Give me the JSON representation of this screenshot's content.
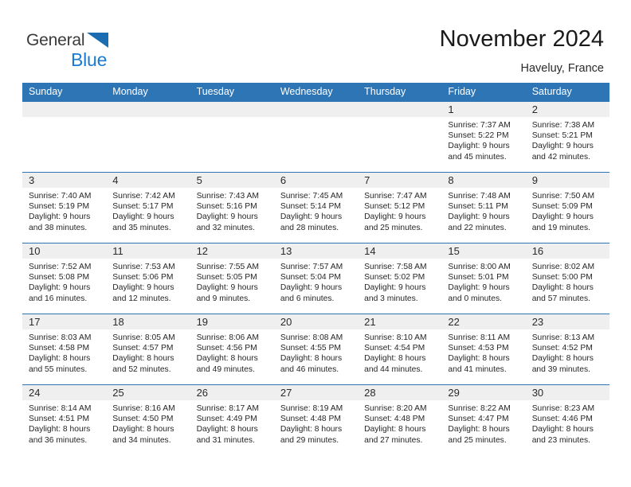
{
  "brand": {
    "name_part1": "General",
    "name_part2": "Blue",
    "logo_icon": "flag-triangle-icon",
    "accent_color": "#1b7ad1"
  },
  "header": {
    "title": "November 2024",
    "subtitle": "Haveluy, France"
  },
  "theme": {
    "header_blue": "#2e75b6",
    "daystrip_gray": "#efefef",
    "text_dark": "#262626"
  },
  "calendar": {
    "weekday_headers": [
      "Sunday",
      "Monday",
      "Tuesday",
      "Wednesday",
      "Thursday",
      "Friday",
      "Saturday"
    ],
    "weeks": [
      [
        {
          "day": "",
          "empty": true,
          "sunrise": "",
          "sunset": "",
          "daylight_line1": "",
          "daylight_line2": ""
        },
        {
          "day": "",
          "empty": true,
          "sunrise": "",
          "sunset": "",
          "daylight_line1": "",
          "daylight_line2": ""
        },
        {
          "day": "",
          "empty": true,
          "sunrise": "",
          "sunset": "",
          "daylight_line1": "",
          "daylight_line2": ""
        },
        {
          "day": "",
          "empty": true,
          "sunrise": "",
          "sunset": "",
          "daylight_line1": "",
          "daylight_line2": ""
        },
        {
          "day": "",
          "empty": true,
          "sunrise": "",
          "sunset": "",
          "daylight_line1": "",
          "daylight_line2": ""
        },
        {
          "day": "1",
          "empty": false,
          "sunrise": "Sunrise: 7:37 AM",
          "sunset": "Sunset: 5:22 PM",
          "daylight_line1": "Daylight: 9 hours",
          "daylight_line2": "and 45 minutes."
        },
        {
          "day": "2",
          "empty": false,
          "sunrise": "Sunrise: 7:38 AM",
          "sunset": "Sunset: 5:21 PM",
          "daylight_line1": "Daylight: 9 hours",
          "daylight_line2": "and 42 minutes."
        }
      ],
      [
        {
          "day": "3",
          "empty": false,
          "sunrise": "Sunrise: 7:40 AM",
          "sunset": "Sunset: 5:19 PM",
          "daylight_line1": "Daylight: 9 hours",
          "daylight_line2": "and 38 minutes."
        },
        {
          "day": "4",
          "empty": false,
          "sunrise": "Sunrise: 7:42 AM",
          "sunset": "Sunset: 5:17 PM",
          "daylight_line1": "Daylight: 9 hours",
          "daylight_line2": "and 35 minutes."
        },
        {
          "day": "5",
          "empty": false,
          "sunrise": "Sunrise: 7:43 AM",
          "sunset": "Sunset: 5:16 PM",
          "daylight_line1": "Daylight: 9 hours",
          "daylight_line2": "and 32 minutes."
        },
        {
          "day": "6",
          "empty": false,
          "sunrise": "Sunrise: 7:45 AM",
          "sunset": "Sunset: 5:14 PM",
          "daylight_line1": "Daylight: 9 hours",
          "daylight_line2": "and 28 minutes."
        },
        {
          "day": "7",
          "empty": false,
          "sunrise": "Sunrise: 7:47 AM",
          "sunset": "Sunset: 5:12 PM",
          "daylight_line1": "Daylight: 9 hours",
          "daylight_line2": "and 25 minutes."
        },
        {
          "day": "8",
          "empty": false,
          "sunrise": "Sunrise: 7:48 AM",
          "sunset": "Sunset: 5:11 PM",
          "daylight_line1": "Daylight: 9 hours",
          "daylight_line2": "and 22 minutes."
        },
        {
          "day": "9",
          "empty": false,
          "sunrise": "Sunrise: 7:50 AM",
          "sunset": "Sunset: 5:09 PM",
          "daylight_line1": "Daylight: 9 hours",
          "daylight_line2": "and 19 minutes."
        }
      ],
      [
        {
          "day": "10",
          "empty": false,
          "sunrise": "Sunrise: 7:52 AM",
          "sunset": "Sunset: 5:08 PM",
          "daylight_line1": "Daylight: 9 hours",
          "daylight_line2": "and 16 minutes."
        },
        {
          "day": "11",
          "empty": false,
          "sunrise": "Sunrise: 7:53 AM",
          "sunset": "Sunset: 5:06 PM",
          "daylight_line1": "Daylight: 9 hours",
          "daylight_line2": "and 12 minutes."
        },
        {
          "day": "12",
          "empty": false,
          "sunrise": "Sunrise: 7:55 AM",
          "sunset": "Sunset: 5:05 PM",
          "daylight_line1": "Daylight: 9 hours",
          "daylight_line2": "and 9 minutes."
        },
        {
          "day": "13",
          "empty": false,
          "sunrise": "Sunrise: 7:57 AM",
          "sunset": "Sunset: 5:04 PM",
          "daylight_line1": "Daylight: 9 hours",
          "daylight_line2": "and 6 minutes."
        },
        {
          "day": "14",
          "empty": false,
          "sunrise": "Sunrise: 7:58 AM",
          "sunset": "Sunset: 5:02 PM",
          "daylight_line1": "Daylight: 9 hours",
          "daylight_line2": "and 3 minutes."
        },
        {
          "day": "15",
          "empty": false,
          "sunrise": "Sunrise: 8:00 AM",
          "sunset": "Sunset: 5:01 PM",
          "daylight_line1": "Daylight: 9 hours",
          "daylight_line2": "and 0 minutes."
        },
        {
          "day": "16",
          "empty": false,
          "sunrise": "Sunrise: 8:02 AM",
          "sunset": "Sunset: 5:00 PM",
          "daylight_line1": "Daylight: 8 hours",
          "daylight_line2": "and 57 minutes."
        }
      ],
      [
        {
          "day": "17",
          "empty": false,
          "sunrise": "Sunrise: 8:03 AM",
          "sunset": "Sunset: 4:58 PM",
          "daylight_line1": "Daylight: 8 hours",
          "daylight_line2": "and 55 minutes."
        },
        {
          "day": "18",
          "empty": false,
          "sunrise": "Sunrise: 8:05 AM",
          "sunset": "Sunset: 4:57 PM",
          "daylight_line1": "Daylight: 8 hours",
          "daylight_line2": "and 52 minutes."
        },
        {
          "day": "19",
          "empty": false,
          "sunrise": "Sunrise: 8:06 AM",
          "sunset": "Sunset: 4:56 PM",
          "daylight_line1": "Daylight: 8 hours",
          "daylight_line2": "and 49 minutes."
        },
        {
          "day": "20",
          "empty": false,
          "sunrise": "Sunrise: 8:08 AM",
          "sunset": "Sunset: 4:55 PM",
          "daylight_line1": "Daylight: 8 hours",
          "daylight_line2": "and 46 minutes."
        },
        {
          "day": "21",
          "empty": false,
          "sunrise": "Sunrise: 8:10 AM",
          "sunset": "Sunset: 4:54 PM",
          "daylight_line1": "Daylight: 8 hours",
          "daylight_line2": "and 44 minutes."
        },
        {
          "day": "22",
          "empty": false,
          "sunrise": "Sunrise: 8:11 AM",
          "sunset": "Sunset: 4:53 PM",
          "daylight_line1": "Daylight: 8 hours",
          "daylight_line2": "and 41 minutes."
        },
        {
          "day": "23",
          "empty": false,
          "sunrise": "Sunrise: 8:13 AM",
          "sunset": "Sunset: 4:52 PM",
          "daylight_line1": "Daylight: 8 hours",
          "daylight_line2": "and 39 minutes."
        }
      ],
      [
        {
          "day": "24",
          "empty": false,
          "sunrise": "Sunrise: 8:14 AM",
          "sunset": "Sunset: 4:51 PM",
          "daylight_line1": "Daylight: 8 hours",
          "daylight_line2": "and 36 minutes."
        },
        {
          "day": "25",
          "empty": false,
          "sunrise": "Sunrise: 8:16 AM",
          "sunset": "Sunset: 4:50 PM",
          "daylight_line1": "Daylight: 8 hours",
          "daylight_line2": "and 34 minutes."
        },
        {
          "day": "26",
          "empty": false,
          "sunrise": "Sunrise: 8:17 AM",
          "sunset": "Sunset: 4:49 PM",
          "daylight_line1": "Daylight: 8 hours",
          "daylight_line2": "and 31 minutes."
        },
        {
          "day": "27",
          "empty": false,
          "sunrise": "Sunrise: 8:19 AM",
          "sunset": "Sunset: 4:48 PM",
          "daylight_line1": "Daylight: 8 hours",
          "daylight_line2": "and 29 minutes."
        },
        {
          "day": "28",
          "empty": false,
          "sunrise": "Sunrise: 8:20 AM",
          "sunset": "Sunset: 4:48 PM",
          "daylight_line1": "Daylight: 8 hours",
          "daylight_line2": "and 27 minutes."
        },
        {
          "day": "29",
          "empty": false,
          "sunrise": "Sunrise: 8:22 AM",
          "sunset": "Sunset: 4:47 PM",
          "daylight_line1": "Daylight: 8 hours",
          "daylight_line2": "and 25 minutes."
        },
        {
          "day": "30",
          "empty": false,
          "sunrise": "Sunrise: 8:23 AM",
          "sunset": "Sunset: 4:46 PM",
          "daylight_line1": "Daylight: 8 hours",
          "daylight_line2": "and 23 minutes."
        }
      ]
    ]
  }
}
